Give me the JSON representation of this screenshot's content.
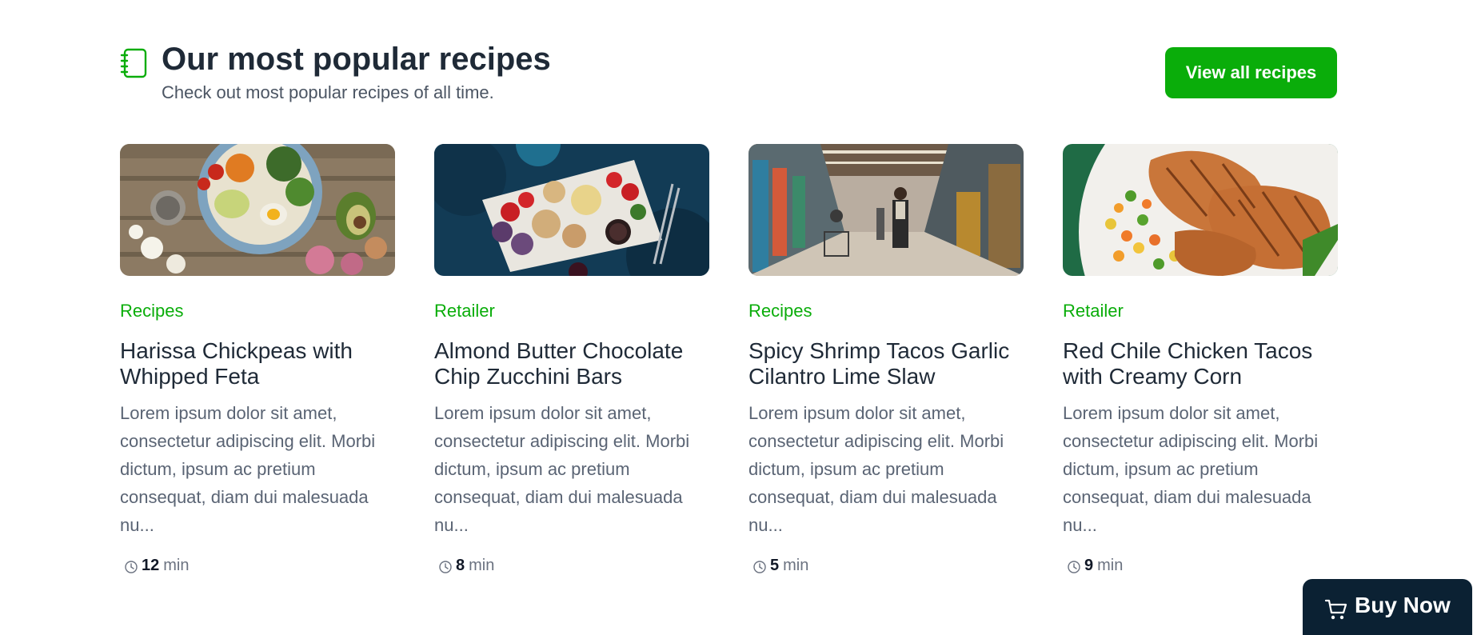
{
  "header": {
    "icon": "notebook-icon",
    "title": "Our most popular recipes",
    "subtitle": "Check out most popular recipes of all time.",
    "view_all_label": "View all recipes"
  },
  "colors": {
    "accent": "#0aad0a",
    "heading": "#1f2a37",
    "body_text": "#5a6474",
    "buy_now_bg": "#0b2133"
  },
  "cards": [
    {
      "image": "salad-bowl-photo",
      "category": "Recipes",
      "title": "Harissa Chickpeas with Whipped Feta",
      "description": "Lorem ipsum dolor sit amet, consectetur adipiscing elit. Morbi dictum, ipsum ac pretium consequat, diam dui malesuada nu...",
      "time_value": "12",
      "time_unit": "min"
    },
    {
      "image": "snack-board-photo",
      "category": "Retailer",
      "title": "Almond Butter Chocolate Chip Zucchini Bars",
      "description": "Lorem ipsum dolor sit amet, consectetur adipiscing elit. Morbi dictum, ipsum ac pretium consequat, diam dui malesuada nu...",
      "time_value": "8",
      "time_unit": "min"
    },
    {
      "image": "grocery-store-photo",
      "category": "Recipes",
      "title": "Spicy Shrimp Tacos Garlic Cilantro Lime Slaw",
      "description": "Lorem ipsum dolor sit amet, consectetur adipiscing elit. Morbi dictum, ipsum ac pretium consequat, diam dui malesuada nu...",
      "time_value": "5",
      "time_unit": "min"
    },
    {
      "image": "grilled-chicken-photo",
      "category": "Retailer",
      "title": "Red Chile Chicken Tacos with Creamy Corn",
      "description": "Lorem ipsum dolor sit amet, consectetur adipiscing elit. Morbi dictum, ipsum ac pretium consequat, diam dui malesuada nu...",
      "time_value": "9",
      "time_unit": "min"
    }
  ],
  "buy_now": {
    "icon": "cart-icon",
    "label": "Buy Now"
  }
}
